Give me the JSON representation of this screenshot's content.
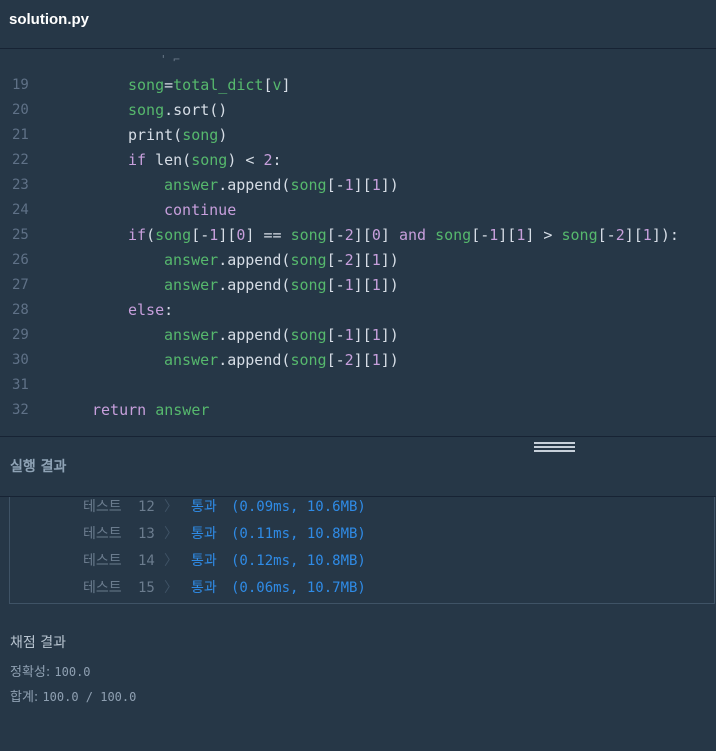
{
  "header": {
    "file_name": "solution.py"
  },
  "editor": {
    "lines": [
      {
        "num": "19",
        "indent": 2,
        "tokens": [
          {
            "t": "song",
            "c": "v"
          },
          {
            "t": "=",
            "c": "p"
          },
          {
            "t": "total_dict",
            "c": "v"
          },
          {
            "t": "[",
            "c": "p"
          },
          {
            "t": "v",
            "c": "v"
          },
          {
            "t": "]",
            "c": "p"
          }
        ]
      },
      {
        "num": "20",
        "indent": 2,
        "tokens": [
          {
            "t": "song",
            "c": "v"
          },
          {
            "t": ".sort()",
            "c": "p"
          }
        ]
      },
      {
        "num": "21",
        "indent": 2,
        "tokens": [
          {
            "t": "print(",
            "c": "p"
          },
          {
            "t": "song",
            "c": "v"
          },
          {
            "t": ")",
            "c": "p"
          }
        ]
      },
      {
        "num": "22",
        "indent": 2,
        "tokens": [
          {
            "t": "if ",
            "c": "kw"
          },
          {
            "t": "len(",
            "c": "p"
          },
          {
            "t": "song",
            "c": "v"
          },
          {
            "t": ") < ",
            "c": "p"
          },
          {
            "t": "2",
            "c": "n"
          },
          {
            "t": ":",
            "c": "p"
          }
        ]
      },
      {
        "num": "23",
        "indent": 3,
        "tokens": [
          {
            "t": "answer",
            "c": "v"
          },
          {
            "t": ".append(",
            "c": "p"
          },
          {
            "t": "song",
            "c": "v"
          },
          {
            "t": "[-",
            "c": "p"
          },
          {
            "t": "1",
            "c": "n"
          },
          {
            "t": "][",
            "c": "p"
          },
          {
            "t": "1",
            "c": "n"
          },
          {
            "t": "])",
            "c": "p"
          }
        ]
      },
      {
        "num": "24",
        "indent": 3,
        "tokens": [
          {
            "t": "continue",
            "c": "kw"
          }
        ]
      },
      {
        "num": "25",
        "indent": 2,
        "tokens": [
          {
            "t": "if",
            "c": "kw"
          },
          {
            "t": "(",
            "c": "p"
          },
          {
            "t": "song",
            "c": "v"
          },
          {
            "t": "[-",
            "c": "p"
          },
          {
            "t": "1",
            "c": "n"
          },
          {
            "t": "][",
            "c": "p"
          },
          {
            "t": "0",
            "c": "n"
          },
          {
            "t": "] == ",
            "c": "p"
          },
          {
            "t": "song",
            "c": "v"
          },
          {
            "t": "[-",
            "c": "p"
          },
          {
            "t": "2",
            "c": "n"
          },
          {
            "t": "][",
            "c": "p"
          },
          {
            "t": "0",
            "c": "n"
          },
          {
            "t": "] ",
            "c": "p"
          },
          {
            "t": "and",
            "c": "kw"
          },
          {
            "t": " ",
            "c": "p"
          },
          {
            "t": "song",
            "c": "v"
          },
          {
            "t": "[-",
            "c": "p"
          },
          {
            "t": "1",
            "c": "n"
          },
          {
            "t": "][",
            "c": "p"
          },
          {
            "t": "1",
            "c": "n"
          },
          {
            "t": "] > ",
            "c": "p"
          },
          {
            "t": "song",
            "c": "v"
          },
          {
            "t": "[-",
            "c": "p"
          },
          {
            "t": "2",
            "c": "n"
          },
          {
            "t": "][",
            "c": "p"
          },
          {
            "t": "1",
            "c": "n"
          },
          {
            "t": "]):",
            "c": "p"
          }
        ]
      },
      {
        "num": "26",
        "indent": 3,
        "tokens": [
          {
            "t": "answer",
            "c": "v"
          },
          {
            "t": ".append(",
            "c": "p"
          },
          {
            "t": "song",
            "c": "v"
          },
          {
            "t": "[-",
            "c": "p"
          },
          {
            "t": "2",
            "c": "n"
          },
          {
            "t": "][",
            "c": "p"
          },
          {
            "t": "1",
            "c": "n"
          },
          {
            "t": "])",
            "c": "p"
          }
        ]
      },
      {
        "num": "27",
        "indent": 3,
        "tokens": [
          {
            "t": "answer",
            "c": "v"
          },
          {
            "t": ".append(",
            "c": "p"
          },
          {
            "t": "song",
            "c": "v"
          },
          {
            "t": "[-",
            "c": "p"
          },
          {
            "t": "1",
            "c": "n"
          },
          {
            "t": "][",
            "c": "p"
          },
          {
            "t": "1",
            "c": "n"
          },
          {
            "t": "])",
            "c": "p"
          }
        ]
      },
      {
        "num": "28",
        "indent": 2,
        "tokens": [
          {
            "t": "else",
            "c": "kw"
          },
          {
            "t": ":",
            "c": "p"
          }
        ]
      },
      {
        "num": "29",
        "indent": 3,
        "tokens": [
          {
            "t": "answer",
            "c": "v"
          },
          {
            "t": ".append(",
            "c": "p"
          },
          {
            "t": "song",
            "c": "v"
          },
          {
            "t": "[-",
            "c": "p"
          },
          {
            "t": "1",
            "c": "n"
          },
          {
            "t": "][",
            "c": "p"
          },
          {
            "t": "1",
            "c": "n"
          },
          {
            "t": "])",
            "c": "p"
          }
        ]
      },
      {
        "num": "30",
        "indent": 3,
        "tokens": [
          {
            "t": "answer",
            "c": "v"
          },
          {
            "t": ".append(",
            "c": "p"
          },
          {
            "t": "song",
            "c": "v"
          },
          {
            "t": "[-",
            "c": "p"
          },
          {
            "t": "2",
            "c": "n"
          },
          {
            "t": "][",
            "c": "p"
          },
          {
            "t": "1",
            "c": "n"
          },
          {
            "t": "])",
            "c": "p"
          }
        ]
      },
      {
        "num": "31",
        "indent": 0,
        "tokens": []
      },
      {
        "num": "32",
        "indent": 1,
        "tokens": [
          {
            "t": "return ",
            "c": "kw"
          },
          {
            "t": "answer",
            "c": "v"
          }
        ]
      }
    ]
  },
  "results": {
    "title": "실행 결과",
    "tests": [
      {
        "label": "테스트",
        "num": "12",
        "chevron": "〉",
        "status": "통과",
        "detail": "(0.09ms, 10.6MB)"
      },
      {
        "label": "테스트",
        "num": "13",
        "chevron": "〉",
        "status": "통과",
        "detail": "(0.11ms, 10.8MB)"
      },
      {
        "label": "테스트",
        "num": "14",
        "chevron": "〉",
        "status": "통과",
        "detail": "(0.12ms, 10.8MB)"
      },
      {
        "label": "테스트",
        "num": "15",
        "chevron": "〉",
        "status": "통과",
        "detail": "(0.06ms, 10.7MB)"
      }
    ]
  },
  "grading": {
    "title": "채점 결과",
    "accuracy_label": "정확성: ",
    "accuracy_value": "100.0",
    "total_label": "합계: ",
    "total_value": "100.0 / 100.0"
  },
  "colors": {
    "background": "#263747",
    "variable": "#56b86d",
    "keyword": "#c79fdc",
    "plain": "#d6dde6",
    "pass": "#2f8be6"
  },
  "icons": {
    "resize_handle": "resize-handle-icon",
    "test_chevron": "chevron-right-icon"
  }
}
